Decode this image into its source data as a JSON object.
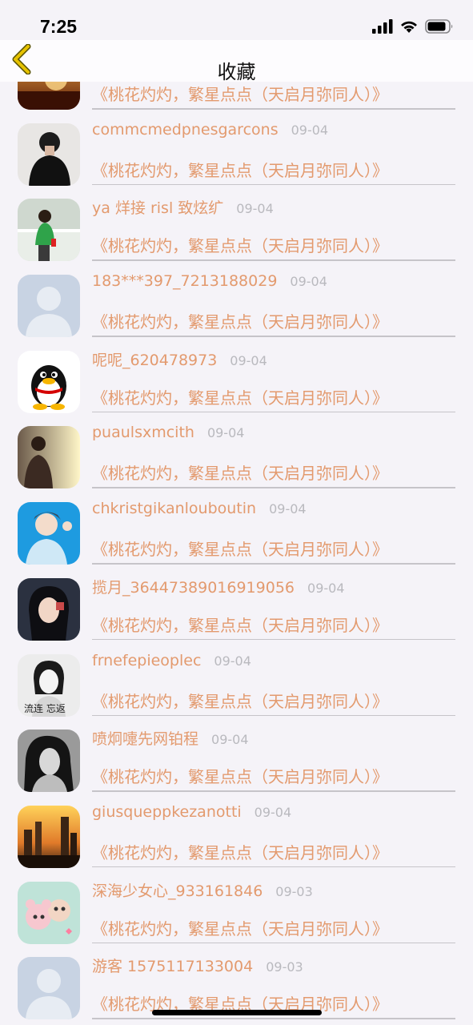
{
  "status_bar": {
    "time": "7:25",
    "icons": [
      "signal-icon",
      "wifi-icon",
      "battery-icon"
    ]
  },
  "nav": {
    "back_icon": "chevron-left-icon",
    "title": "收藏"
  },
  "colors": {
    "accent": "#e39a6e",
    "back_arrow": "#e6c200",
    "date": "#b9b9be",
    "background": "#f5f3f8"
  },
  "items": [
    {
      "name": "",
      "date": "",
      "content": "《桃花灼灼，繁星点点（天启月弥同人）》",
      "avatar": "sunset-photo"
    },
    {
      "name": "commcmedpnesgarcons",
      "date": "09-04",
      "content": "《桃花灼灼，繁星点点（天启月弥同人）》",
      "avatar": "person-photo"
    },
    {
      "name": "ya 烊接 risl 致炫纩",
      "date": "09-04",
      "content": "《桃花灼灼，繁星点点（天启月弥同人）》",
      "avatar": "green-photo"
    },
    {
      "name": "183***397_7213188029",
      "date": "09-04",
      "content": "《桃花灼灼，繁星点点（天启月弥同人）》",
      "avatar": "default-avatar"
    },
    {
      "name": "呢呢_620478973",
      "date": "09-04",
      "content": "《桃花灼灼，繁星点点（天启月弥同人）》",
      "avatar": "penguin-avatar"
    },
    {
      "name": "puaulsxmcith",
      "date": "09-04",
      "content": "《桃花灼灼，繁星点点（天启月弥同人）》",
      "avatar": "man-photo"
    },
    {
      "name": "chkristgikanlouboutin",
      "date": "09-04",
      "content": "《桃花灼灼，繁星点点（天启月弥同人）》",
      "avatar": "anime-avatar"
    },
    {
      "name": "揽月_36447389016919056",
      "date": "09-04",
      "content": "《桃花灼灼，繁星点点（天启月弥同人）》",
      "avatar": "girl-photo"
    },
    {
      "name": "frnefepieoplec",
      "date": "09-04",
      "content": "《桃花灼灼，繁星点点（天启月弥同人）》",
      "avatar": "bw-photo",
      "avatar_text": "流连   忘返"
    },
    {
      "name": "喷炯嚏先网铂程",
      "date": "09-04",
      "content": "《桃花灼灼，繁星点点（天启月弥同人）》",
      "avatar": "woman-bw-photo"
    },
    {
      "name": "giusqueppkezanotti",
      "date": "09-04",
      "content": "《桃花灼灼，繁星点点（天启月弥同人）》",
      "avatar": "city-photo"
    },
    {
      "name": "深海少女心_933161846",
      "date": "09-03",
      "content": "《桃花灼灼，繁星点点（天启月弥同人）》",
      "avatar": "cute-photo"
    },
    {
      "name": "游客 1575117133004",
      "date": "09-03",
      "content": "《桃花灼灼，繁星点点（天启月弥同人）》",
      "avatar": "default-avatar"
    }
  ]
}
